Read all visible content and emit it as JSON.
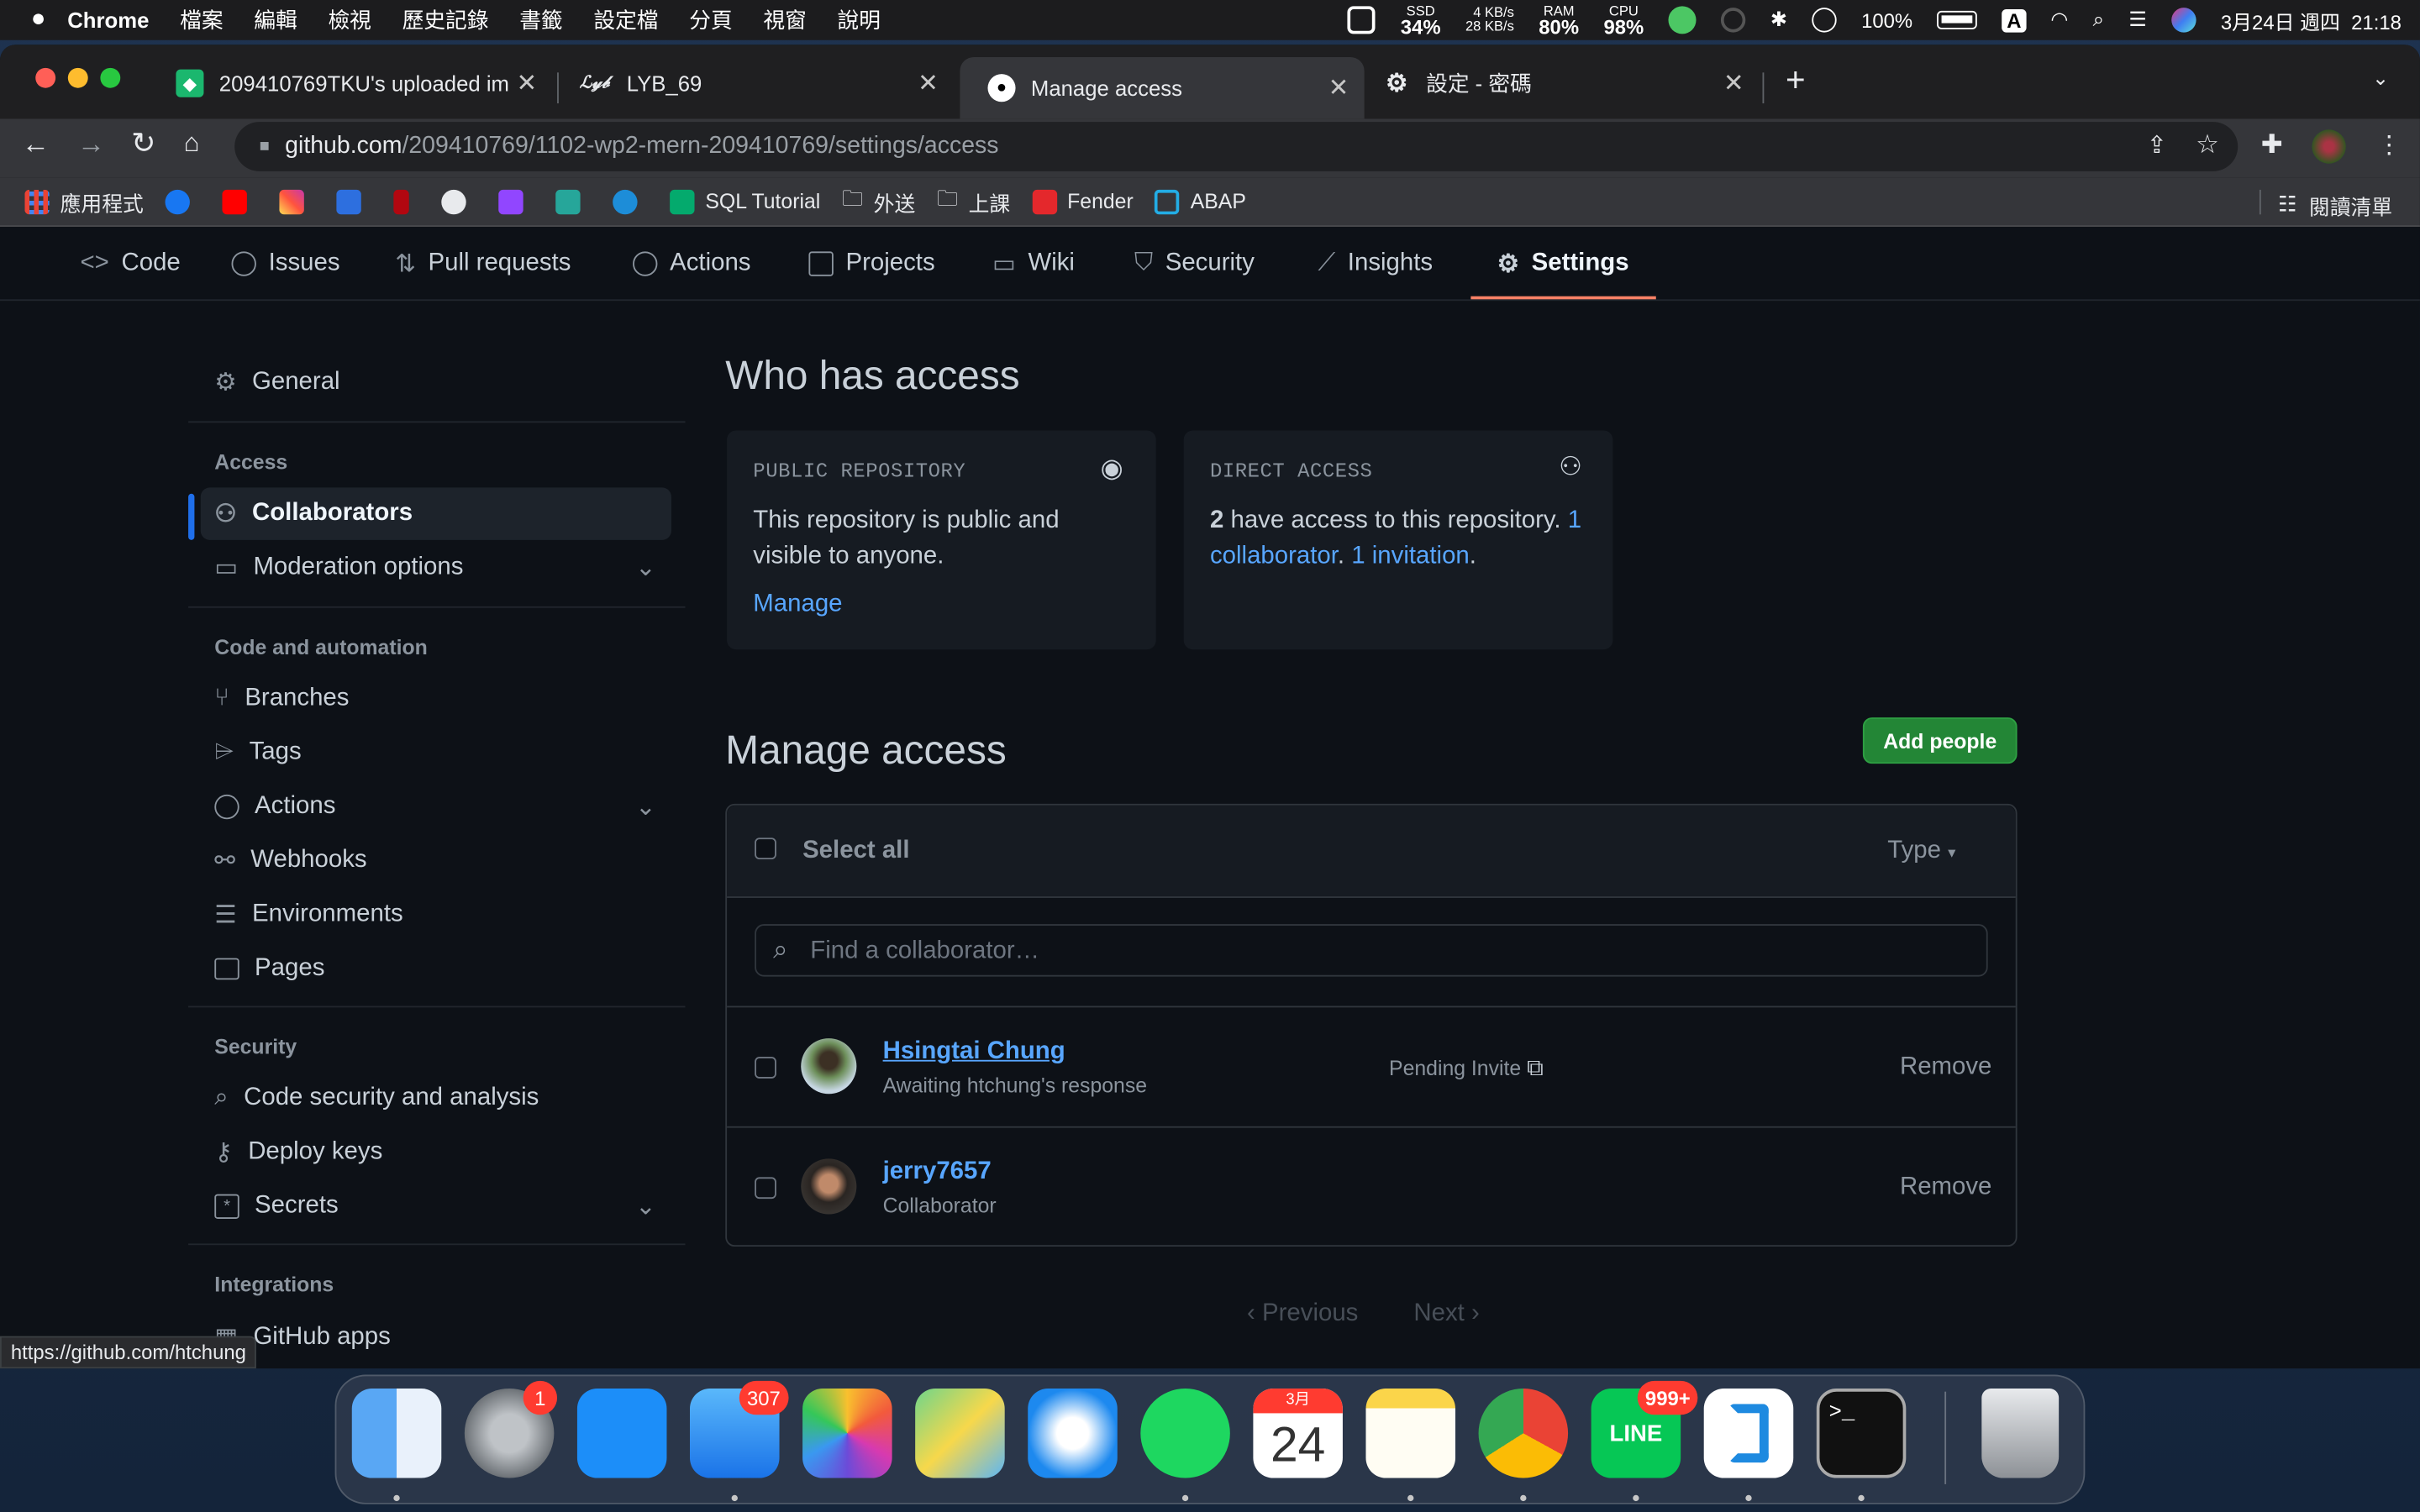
{
  "menubar": {
    "app": "Chrome",
    "items": [
      "檔案",
      "編輯",
      "檢視",
      "歷史記錄",
      "書籤",
      "設定檔",
      "分頁",
      "視窗",
      "說明"
    ],
    "ssd_label": "SSD",
    "ssd": "34%",
    "net_up": "4 KB/s",
    "net_down": "28 KB/s",
    "ram_label": "RAM",
    "ram": "80%",
    "cpu_label": "CPU",
    "cpu": "98%",
    "battery": "100%",
    "input": "A",
    "datetime": "3月24日 週四  21:18"
  },
  "tabs": [
    {
      "title": "209410769TKU's uploaded im"
    },
    {
      "title": "LYB_69",
      "icon_text": "ℒ𝓎𝒷"
    },
    {
      "title": "Manage access"
    },
    {
      "title": "設定 - 密碼"
    }
  ],
  "address": {
    "host": "github.com",
    "path": "/209410769/1102-wp2-mern-209410769/settings/access"
  },
  "bookmarks": {
    "apps": "應用程式",
    "sql": "SQL Tutorial",
    "f1": "外送",
    "f2": "上課",
    "fender": "Fender",
    "abap": "ABAP",
    "reading_list": "閱讀清單"
  },
  "repo_nav": [
    "Code",
    "Issues",
    "Pull requests",
    "Actions",
    "Projects",
    "Wiki",
    "Security",
    "Insights",
    "Settings"
  ],
  "sidebar": {
    "general": "General",
    "access_head": "Access",
    "collaborators": "Collaborators",
    "moderation": "Moderation options",
    "code_head": "Code and automation",
    "branches": "Branches",
    "tags": "Tags",
    "actions": "Actions",
    "webhooks": "Webhooks",
    "environments": "Environments",
    "pages": "Pages",
    "security_head": "Security",
    "code_security": "Code security and analysis",
    "deploy_keys": "Deploy keys",
    "secrets": "Secrets",
    "integrations_head": "Integrations",
    "github_apps": "GitHub apps"
  },
  "who": {
    "title": "Who has access",
    "public_label": "PUBLIC REPOSITORY",
    "public_line1": "This repository is public and",
    "public_line2": "visible to anyone.",
    "manage": "Manage",
    "direct_label": "DIRECT ACCESS",
    "count": "2",
    "direct_text": " have access to this repository. ",
    "collab_1": "1",
    "collab_2": "collaborator",
    "dot": ".",
    "invitation": "1 invitation",
    "dot2": "."
  },
  "manage": {
    "title": "Manage access",
    "add_people": "Add people",
    "select_all": "Select all",
    "type": "Type",
    "search_placeholder": "Find a collaborator…",
    "rows": [
      {
        "name": "Hsingtai Chung",
        "sub": "Awaiting htchung's response",
        "status": "Pending Invite",
        "action": "Remove"
      },
      {
        "name": "jerry7657",
        "sub": "Collaborator",
        "action": "Remove"
      }
    ],
    "previous": "Previous",
    "next": "Next"
  },
  "status_url": "https://github.com/htchung",
  "dock": {
    "settings_badge": "1",
    "mail_badge": "307",
    "calendar_month": "3月",
    "calendar_day": "24",
    "line_badge": "999+",
    "line_text": "LINE"
  }
}
